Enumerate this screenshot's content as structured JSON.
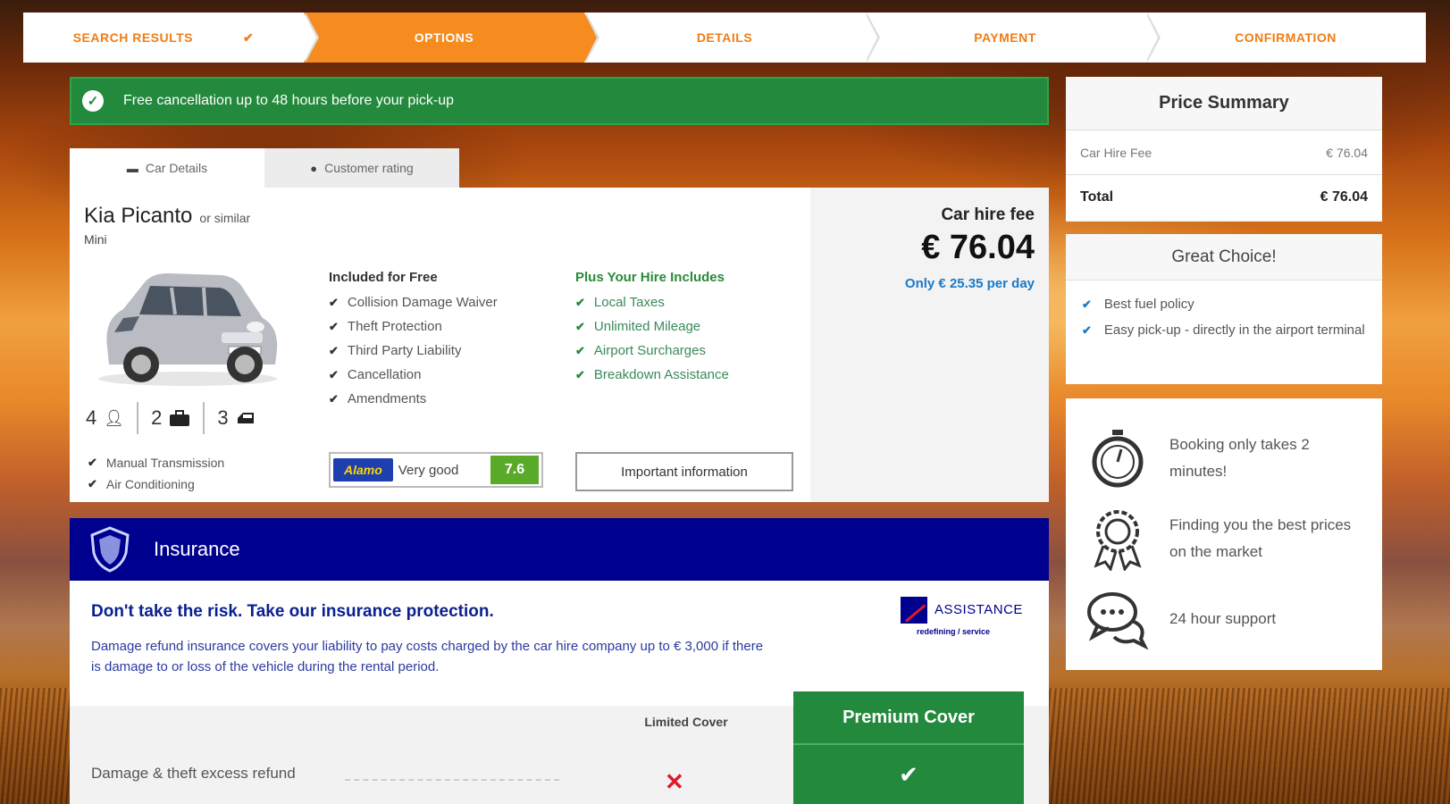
{
  "steps": [
    {
      "label": "SEARCH RESULTS",
      "done": true
    },
    {
      "label": "OPTIONS",
      "active": true
    },
    {
      "label": "DETAILS"
    },
    {
      "label": "PAYMENT"
    },
    {
      "label": "CONFIRMATION"
    }
  ],
  "banner": {
    "text": "Free cancellation up to 48 hours before your pick-up"
  },
  "tabs": {
    "car_details": "Car Details",
    "customer_rating": "Customer rating"
  },
  "car": {
    "name": "Kia Picanto",
    "similar": "or similar",
    "class": "Mini",
    "specs": {
      "passengers": "4",
      "bags": "2",
      "doors": "3"
    },
    "features": [
      "Manual Transmission",
      "Air Conditioning"
    ],
    "included_title": "Included for Free",
    "included": [
      "Collision Damage Waiver",
      "Theft Protection",
      "Third Party Liability",
      "Cancellation",
      "Amendments"
    ],
    "plus_title": "Plus Your Hire Includes",
    "plus": [
      "Local Taxes",
      "Unlimited Mileage",
      "Airport Surcharges",
      "Breakdown Assistance"
    ],
    "supplier": "Alamo",
    "rating_label": "Very good",
    "rating_score": "7.6",
    "info_button": "Important information",
    "fee_label": "Car hire fee",
    "fee_amount": "€ 76.04",
    "per_day": "Only € 25.35 per day"
  },
  "insurance": {
    "header": "Insurance",
    "title": "Don't take the risk. Take our insurance protection.",
    "description": "Damage refund insurance covers your liability to pay costs charged by the car hire company up to € 3,000 if there is damage to or loss of the vehicle during the rental period.",
    "provider": "ASSISTANCE",
    "provider_sub": "redefining / service",
    "limited_label": "Limited Cover",
    "premium_label": "Premium Cover",
    "row_label": "Damage & theft excess refund"
  },
  "summary": {
    "title": "Price Summary",
    "fee_label": "Car Hire Fee",
    "fee_value": "€ 76.04",
    "total_label": "Total",
    "total_value": "€ 76.04"
  },
  "choice": {
    "title": "Great Choice!",
    "items": [
      "Best fuel policy",
      "Easy pick-up - directly in the airport terminal"
    ]
  },
  "benefits": [
    "Booking only takes 2 minutes!",
    "Finding you the best prices on the market",
    "24 hour support"
  ],
  "colors": {
    "accent": "#f68b1f",
    "success": "#23893c",
    "insurance": "#00008f",
    "link": "#1a7ac8"
  }
}
